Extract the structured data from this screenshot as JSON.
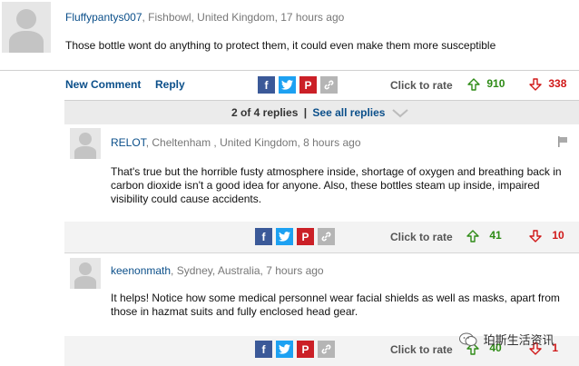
{
  "main_comment": {
    "username": "Fluffypantys007",
    "location_time": ", Fishbowl, United Kingdom, 17 hours ago",
    "text": "Those bottle wont do anything to protect them, it could even make them more susceptible",
    "new_comment_label": "New Comment",
    "reply_label": "Reply",
    "click_to_rate": "Click to rate",
    "up_votes": "910",
    "down_votes": "338"
  },
  "replies_bar": {
    "count_label": "2 of 4 replies",
    "separator": "|",
    "see_all_label": "See all replies"
  },
  "replies": [
    {
      "username": "RELOT",
      "location_time": ", Cheltenham , United Kingdom, 8 hours ago",
      "text": "That's true but the horrible fusty atmosphere inside, shortage of oxygen and breathing back in carbon dioxide isn't a good idea for anyone. Also, these bottles steam up inside, impaired visibility could cause accidents.",
      "click_to_rate": "Click to rate",
      "up_votes": "41",
      "down_votes": "10"
    },
    {
      "username": "keenonmath",
      "location_time": ", Sydney, Australia, 7 hours ago",
      "text": "It helps! Notice how some medical personnel wear facial shields as well as masks, apart from those in hazmat suits and fully enclosed head gear.",
      "click_to_rate": "Click to rate",
      "up_votes": "40",
      "down_votes": "1"
    }
  ],
  "share_icons": {
    "facebook": "f",
    "pinterest": "P"
  },
  "watermark": {
    "text": "珀斯生活资讯"
  },
  "colors": {
    "link_blue": "#0b4f8a",
    "up_green": "#2e8b16",
    "down_red": "#d01818"
  }
}
